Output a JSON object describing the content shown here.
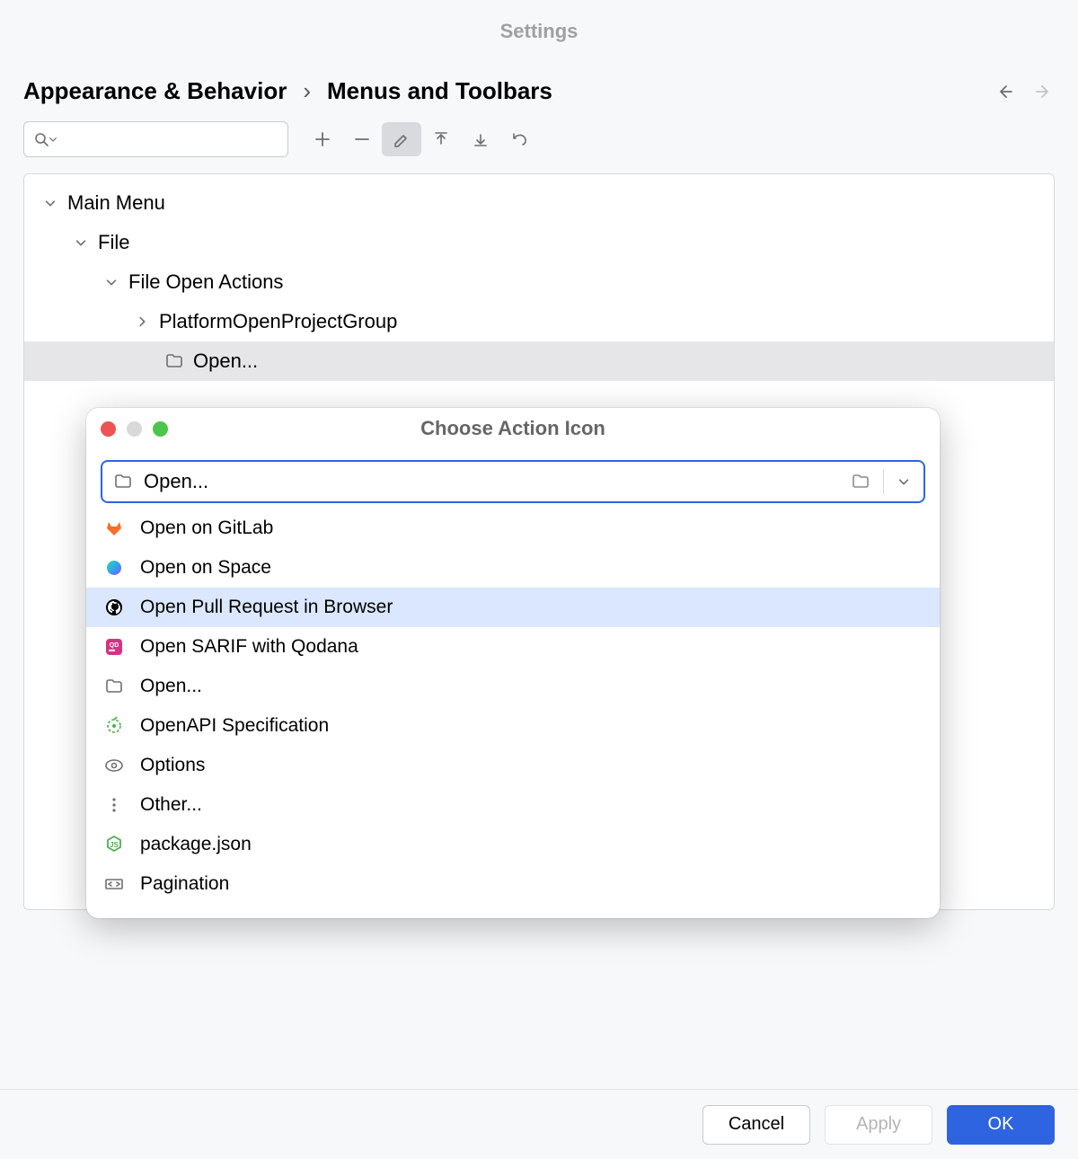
{
  "title": "Settings",
  "breadcrumb": {
    "a": "Appearance & Behavior",
    "b": "Menus and Toolbars"
  },
  "tree": {
    "main_menu": "Main Menu",
    "file": "File",
    "file_open_actions": "File Open Actions",
    "platform_group": "PlatformOpenProjectGroup",
    "open": "Open..."
  },
  "popup": {
    "title": "Choose Action Icon",
    "input_value": "Open...",
    "items": [
      "Open on GitLab",
      "Open on Space",
      "Open Pull Request in Browser",
      "Open SARIF with Qodana",
      "Open...",
      "OpenAPI Specification",
      "Options",
      "Other...",
      "package.json",
      "Pagination"
    ]
  },
  "buttons": {
    "cancel": "Cancel",
    "apply": "Apply",
    "ok": "OK"
  }
}
